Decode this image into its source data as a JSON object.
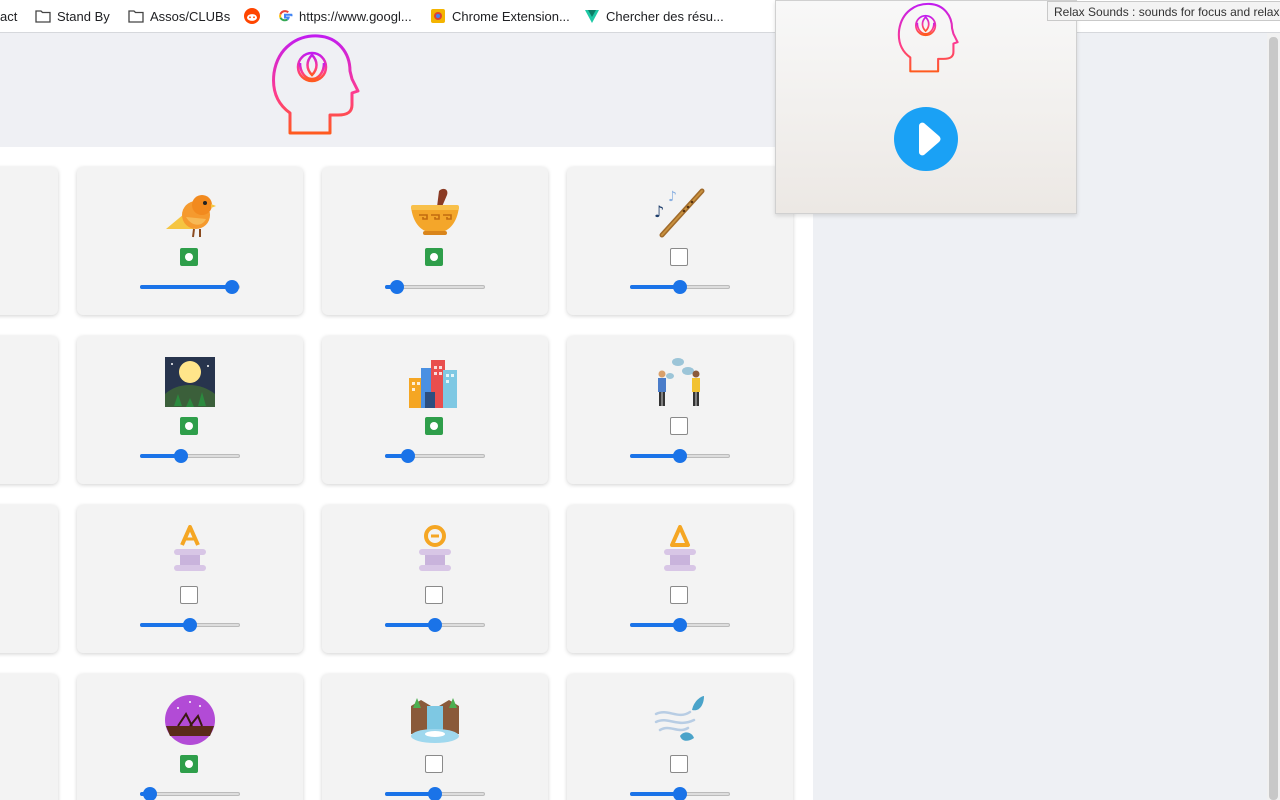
{
  "bookmarks": [
    {
      "label": "act",
      "icon": "none"
    },
    {
      "label": "Stand By",
      "icon": "folder-icon"
    },
    {
      "label": "Assos/CLUBs",
      "icon": "folder-icon"
    },
    {
      "label": "",
      "icon": "reddit-icon"
    },
    {
      "label": "https://www.googl...",
      "icon": "google-icon"
    },
    {
      "label": "Chrome Extension...",
      "icon": "extension-icon"
    },
    {
      "label": "Chercher des résu...",
      "icon": "vuetify-icon"
    }
  ],
  "tooltip": "Relax Sounds : sounds for focus and relax",
  "colors": {
    "accent": "#1a73e8",
    "checked": "#2e9e4a",
    "play": "#1aa1f5"
  },
  "sounds": [
    {
      "icon": "bird-icon",
      "checked": true,
      "volume": 0.92
    },
    {
      "icon": "singing-bowl-icon",
      "checked": true,
      "volume": 0.12
    },
    {
      "icon": "flute-icon",
      "checked": false,
      "volume": 0.5
    },
    {
      "icon": "night-forest-icon",
      "checked": true,
      "volume": 0.41
    },
    {
      "icon": "city-icon",
      "checked": true,
      "volume": 0.23
    },
    {
      "icon": "people-talking-icon",
      "checked": false,
      "volume": 0.5
    },
    {
      "icon": "alpha-wave-icon",
      "checked": false,
      "volume": 0.5
    },
    {
      "icon": "theta-wave-icon",
      "checked": false,
      "volume": 0.5
    },
    {
      "icon": "delta-wave-icon",
      "checked": false,
      "volume": 0.5
    },
    {
      "icon": "crickets-night-icon",
      "checked": true,
      "volume": 0.1
    },
    {
      "icon": "waterfall-icon",
      "checked": false,
      "volume": 0.5
    },
    {
      "icon": "wind-leaf-icon",
      "checked": false,
      "volume": 0.5
    }
  ],
  "popup": {
    "play_icon": "play-icon",
    "logo_icon": "mind-logo-icon"
  }
}
